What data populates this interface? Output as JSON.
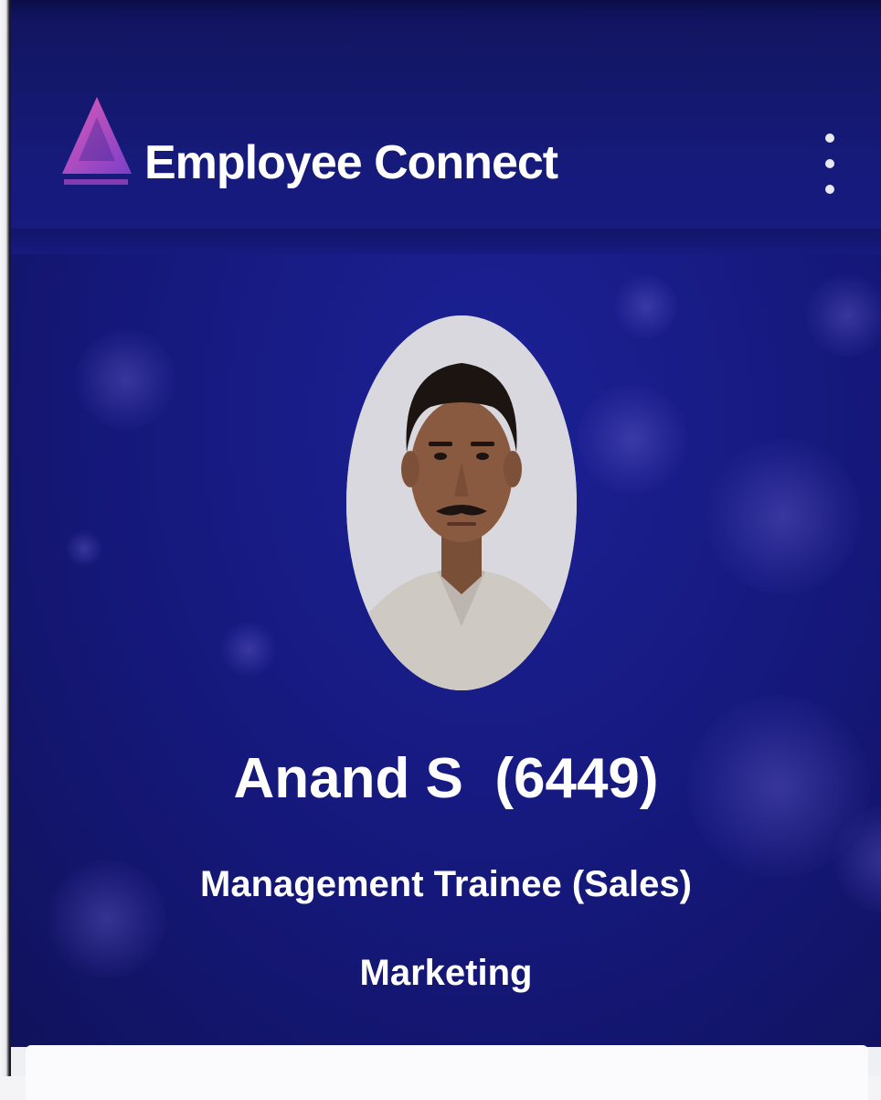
{
  "app": {
    "title": "Employee Connect",
    "logo_icon": "triangle-logo-icon",
    "menu_icon": "more-vertical-icon"
  },
  "profile": {
    "name_line": "Anand S  (6449)",
    "designation": "Management Trainee (Sales)",
    "department": "Marketing",
    "avatar_icon": "profile-photo"
  },
  "colors": {
    "header_bg": "#141872",
    "screen_bg": "#1a1f8e",
    "text": "#ffffff",
    "logo_accent": "#c04fd0"
  }
}
